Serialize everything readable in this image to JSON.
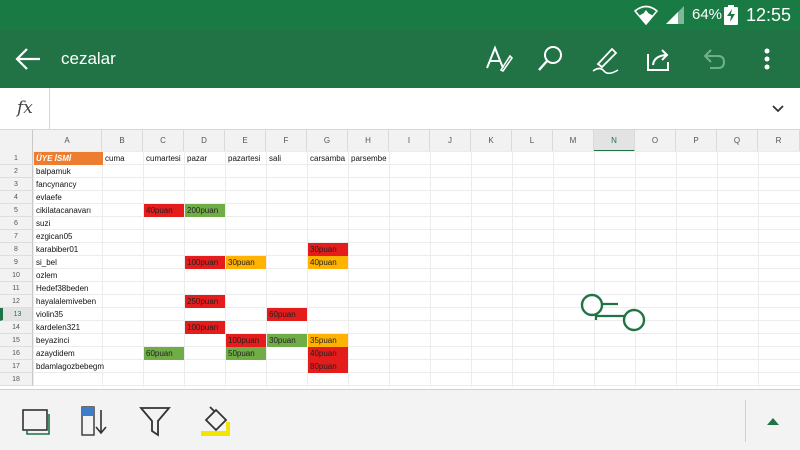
{
  "status": {
    "battery": "64%",
    "time": "12:55",
    "icons": [
      "wifi-icon",
      "signal-icon",
      "battery-charging-icon"
    ]
  },
  "appbar": {
    "title": "cezalar",
    "buttons": [
      "back-arrow-icon",
      "text-format-icon",
      "search-icon",
      "pen-draw-icon",
      "share-icon",
      "undo-icon",
      "more-vert-icon"
    ]
  },
  "formula": {
    "fx": "fx",
    "value": ""
  },
  "columns": [
    "A",
    "B",
    "C",
    "D",
    "E",
    "F",
    "G",
    "H",
    "I",
    "J",
    "K",
    "L",
    "M",
    "N",
    "O",
    "P",
    "Q",
    "R"
  ],
  "selected_column": "N",
  "rows": [
    "1",
    "2",
    "3",
    "4",
    "5",
    "6",
    "7",
    "8",
    "9",
    "10",
    "11",
    "12",
    "13",
    "14",
    "15",
    "16",
    "17",
    "18"
  ],
  "selected_row": "13",
  "header_row": [
    "ÜYE İSMİ",
    "cuma",
    "cumartesi",
    "pazar",
    "pazartesi",
    "sali",
    "carsamba",
    "parsembe"
  ],
  "members": [
    "balpamuk",
    "fancynancy",
    "evlaefe",
    "cikilatacanavarı",
    "suzi",
    "ezgican05",
    "karabiber01",
    "si_bel",
    "ozlem",
    "Hedef38beden",
    "hayalalemiveben",
    "violin35",
    "kardelen321",
    "beyazinci",
    "azaydidem",
    "bdamlagozbebegm"
  ],
  "penalties": [
    {
      "row": "5",
      "col": "C",
      "text": "40puan",
      "color": "#e51c1c"
    },
    {
      "row": "5",
      "col": "D",
      "text": "200puan",
      "color": "#70ad47"
    },
    {
      "row": "8",
      "col": "G",
      "text": "30puan",
      "color": "#e51c1c"
    },
    {
      "row": "9",
      "col": "D",
      "text": "100puan",
      "color": "#e51c1c"
    },
    {
      "row": "9",
      "col": "E",
      "text": "30puan",
      "color": "#ffb300"
    },
    {
      "row": "9",
      "col": "G",
      "text": "40puan",
      "color": "#ffb300"
    },
    {
      "row": "12",
      "col": "D",
      "text": "250puan",
      "color": "#e51c1c"
    },
    {
      "row": "13",
      "col": "F",
      "text": "60puan",
      "color": "#e51c1c"
    },
    {
      "row": "14",
      "col": "D",
      "text": "100puan",
      "color": "#e51c1c"
    },
    {
      "row": "15",
      "col": "E",
      "text": "100puan",
      "color": "#e51c1c"
    },
    {
      "row": "15",
      "col": "F",
      "text": "30puan",
      "color": "#70ad47"
    },
    {
      "row": "15",
      "col": "G",
      "text": "35puan",
      "color": "#ffb300"
    },
    {
      "row": "16",
      "col": "C",
      "text": "60puan",
      "color": "#70ad47"
    },
    {
      "row": "16",
      "col": "E",
      "text": "50puan",
      "color": "#70ad47"
    },
    {
      "row": "16",
      "col": "G",
      "text": "40puan",
      "color": "#e51c1c"
    },
    {
      "row": "17",
      "col": "G",
      "text": "80puan",
      "color": "#e51c1c"
    }
  ],
  "header_fill": "#ed7d31",
  "accent": "#217346",
  "bottom_toolbar": [
    "select-sheet-icon",
    "sort-icon",
    "filter-icon",
    "fill-color-icon",
    "expand-up-icon"
  ]
}
